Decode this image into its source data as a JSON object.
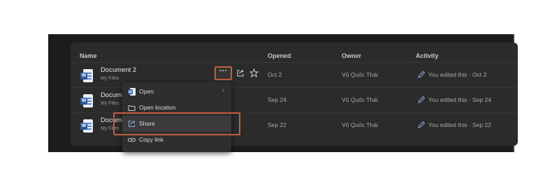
{
  "table": {
    "headers": {
      "name": "Name",
      "opened": "Opened",
      "owner": "Owner",
      "activity": "Activity"
    },
    "rows": [
      {
        "name": "Document 2",
        "location": "My Files",
        "opened": "Oct 2",
        "owner": "Vũ Quốc Thái",
        "activity": "You edited this · Oct 2"
      },
      {
        "name": "Docume",
        "location": "My Files",
        "opened": "Sep 24",
        "owner": "Vũ Quốc Thái",
        "activity": "You edited this · Sep 24"
      },
      {
        "name": "Docume",
        "location": "My Files",
        "opened": "Sep 22",
        "owner": "Vũ Quốc Thái",
        "activity": "You edited this · Sep 22"
      }
    ],
    "more_label": "···",
    "file_badge": "W"
  },
  "context_menu": {
    "items": [
      {
        "label": "Open",
        "icon": "word-icon",
        "has_submenu": true,
        "chevron": "›"
      },
      {
        "label": "Open location",
        "icon": "folder-icon"
      },
      {
        "label": "Share",
        "icon": "share-icon",
        "highlighted": true
      },
      {
        "label": "Copy link",
        "icon": "link-icon"
      }
    ]
  },
  "colors": {
    "background": "#1c1c1c",
    "panel": "#2b2b2b",
    "highlight_box": "#c25e3e",
    "word_blue": "#2b5797"
  }
}
